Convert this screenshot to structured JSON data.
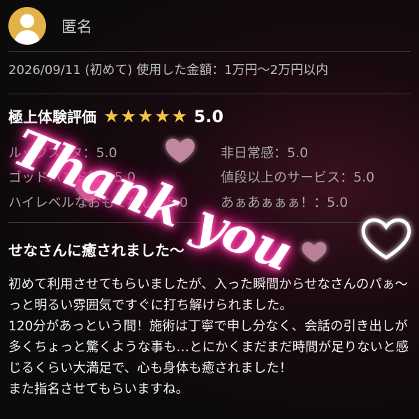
{
  "user": {
    "name": "匿名"
  },
  "review": {
    "meta": "2026/09/11 (初めて) 使用した金額：1万円〜2万円以内",
    "rating_label": "極上体験評価",
    "stars": 5,
    "score": "5.0",
    "subratings": [
      {
        "label": "ルックスSタ：5.0"
      },
      {
        "label": "非日常感：5.0"
      },
      {
        "label": "ゴッドハンド技：5.0"
      },
      {
        "label": "値段以上のサービス：5.0"
      },
      {
        "label": "ハイレベルなおもてなし：5.0"
      },
      {
        "label": "あぁあぁぁぁ！：5.0"
      }
    ],
    "title": "せなさんに癒されました〜",
    "body": "初めて利用させてもらいましたが、入った瞬間からせなさんのパぁ〜っと明るい雰囲気ですぐに打ち解けられました。\n120分があっという間！施術は丁寧で申し分なく、会話の引き出しが多くちょっと驚くような事も…とにかくまだまだ時間が足りないと感じるくらい大満足で、心も身体も癒されました！\nまた指名させてもらいますね。"
  },
  "overlay": {
    "text": "Thank you"
  },
  "colors": {
    "star": "#f4c542",
    "avatar": "#e3b34a",
    "glow": "#ff4fb0"
  }
}
